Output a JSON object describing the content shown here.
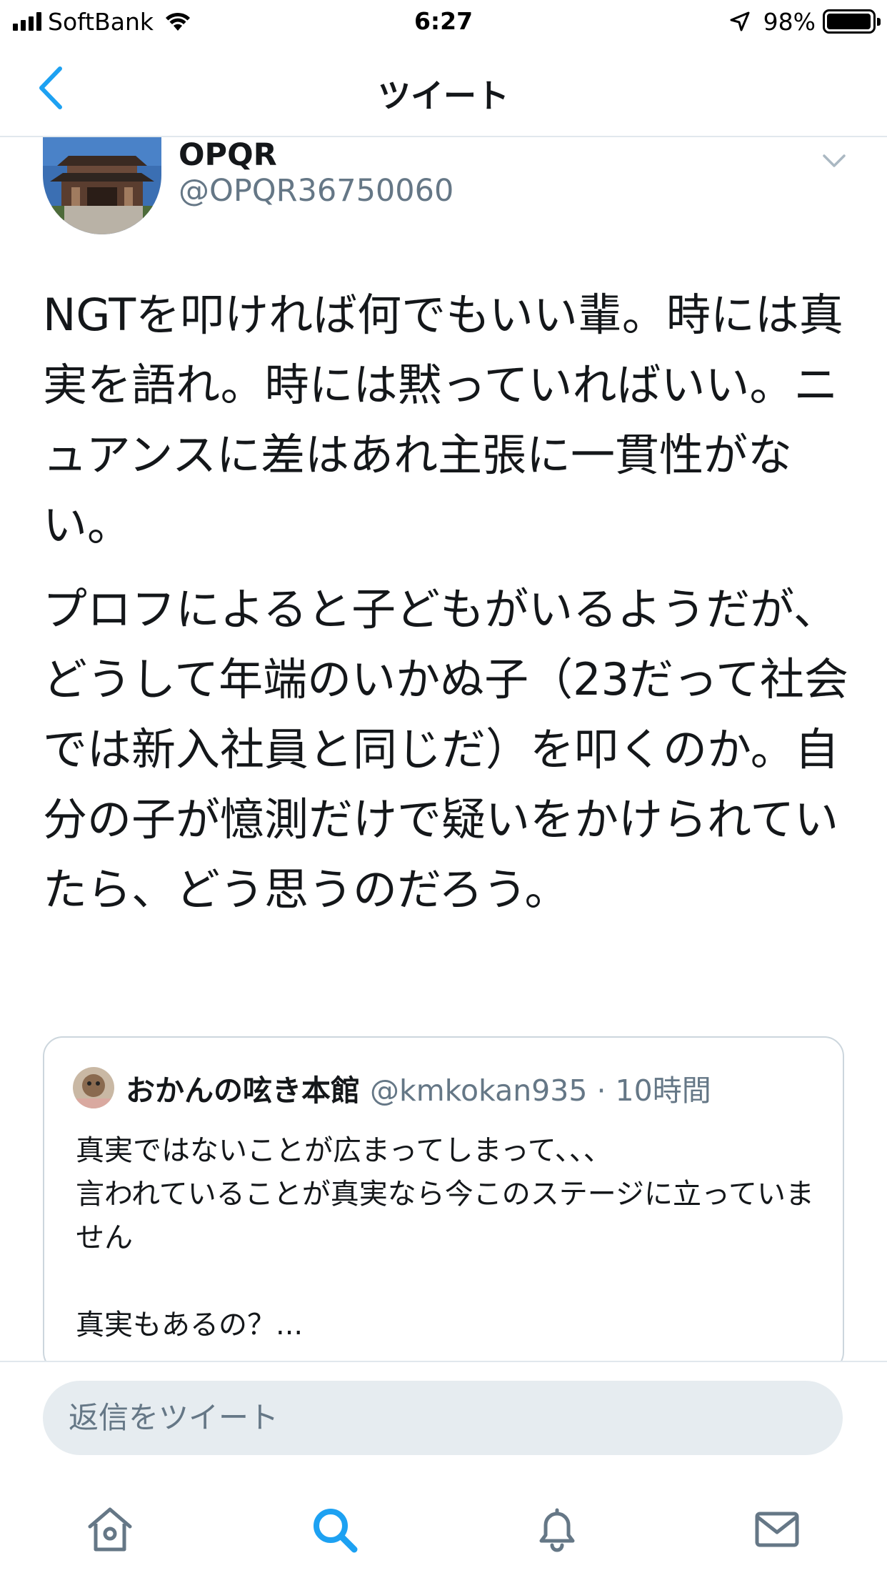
{
  "status_bar": {
    "carrier": "SoftBank",
    "time": "6:27",
    "battery_percent": "98%",
    "battery_level": 0.98
  },
  "nav": {
    "title": "ツイート"
  },
  "tweet": {
    "author_name": "OPQR",
    "author_handle": "@OPQR36750060",
    "paragraphs": [
      "NGTを叩ければ何でもいい輩。時には真実を語れ。時には黙っていればいい。ニュアンスに差はあれ主張に一貫性がない。",
      "プロフによると子どもがいるようだが、どうして年端のいかぬ子（23だって社会では新入社員と同じだ）を叩くのか。自分の子が憶測だけで疑いをかけられていたら、どう思うのだろう。"
    ]
  },
  "quoted_tweet": {
    "author_name": "おかんの呟き本館",
    "author_handle": "@kmkokan935 · 10時間",
    "text": "真実ではないことが広まってしまって、、、\n言われていることが真実なら今このステージに立っていません\n\n真実もあるの？..."
  },
  "reply": {
    "placeholder": "返信をツイート"
  },
  "tab_bar": {
    "items": [
      "home-icon",
      "search-icon",
      "notifications-icon",
      "messages-icon"
    ],
    "active": "search-icon"
  },
  "colors": {
    "accent": "#1da1f2",
    "icon_inactive": "#657786",
    "border": "#e1e8ed"
  }
}
